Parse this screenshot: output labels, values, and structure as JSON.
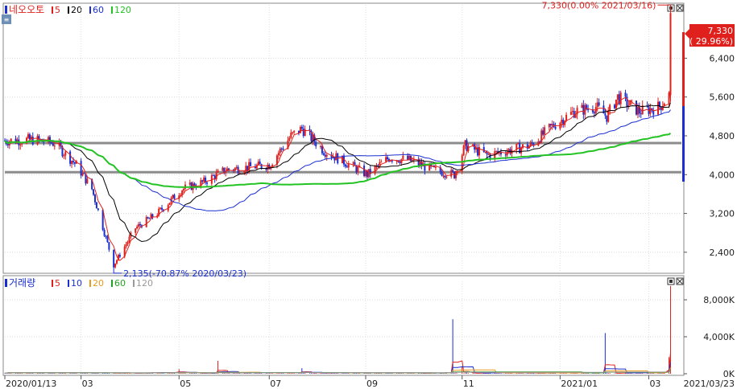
{
  "price_panel": {
    "stock_name": "네오오토",
    "ma_legend": [
      {
        "label": "5",
        "color": "#e0201c"
      },
      {
        "label": "20",
        "color": "#000000"
      },
      {
        "label": "60",
        "color": "#1b2fd0"
      },
      {
        "label": "120",
        "color": "#22c322"
      }
    ],
    "high_annotation": "7,330(0.00% 2021/03/16)",
    "low_annotation": "2,135(-70.87% 2020/03/23)",
    "current_price": "7,330",
    "current_change": "( 29.96%)",
    "y_ticks": [
      "6,400",
      "5,600",
      "4,800",
      "4,000",
      "3,200",
      "2,400"
    ]
  },
  "volume_panel": {
    "title": "거래량",
    "ma_legend": [
      {
        "label": "5",
        "color": "#e0201c"
      },
      {
        "label": "10",
        "color": "#1b2fd0"
      },
      {
        "label": "20",
        "color": "#e89a1a"
      },
      {
        "label": "60",
        "color": "#22a022"
      },
      {
        "label": "120",
        "color": "#999999"
      }
    ],
    "y_ticks": [
      "8,000K",
      "4,000K",
      "0K"
    ]
  },
  "x_axis": {
    "labels": [
      "2020/01/13",
      "03",
      "05",
      "07",
      "09",
      "11",
      "2021/01",
      "03"
    ],
    "end_label": "2021/03/23"
  },
  "colors": {
    "up": "#e0201c",
    "down": "#1b2fd0",
    "support_line": "#8c8c8c"
  },
  "chart_data": [
    {
      "type": "candlestick",
      "title": "네오오토",
      "x_range": [
        "2020/01/13",
        "2021/03/23"
      ],
      "ylim": [
        2000,
        7500
      ],
      "y_ticks": [
        6400,
        5600,
        4800,
        4000,
        3200,
        2400
      ],
      "horizontal_levels": [
        4650,
        4050
      ],
      "close_series": [
        {
          "date": "2020/01/13",
          "value": 4700
        },
        {
          "date": "2020/01/31",
          "value": 4720
        },
        {
          "date": "2020/02/14",
          "value": 4650
        },
        {
          "date": "2020/02/28",
          "value": 4200
        },
        {
          "date": "2020/03/09",
          "value": 3700
        },
        {
          "date": "2020/03/23",
          "value": 2135
        },
        {
          "date": "2020/04/06",
          "value": 2900
        },
        {
          "date": "2020/04/20",
          "value": 3200
        },
        {
          "date": "2020/05/06",
          "value": 3700
        },
        {
          "date": "2020/05/20",
          "value": 3850
        },
        {
          "date": "2020/06/03",
          "value": 4100
        },
        {
          "date": "2020/06/17",
          "value": 4150
        },
        {
          "date": "2020/07/01",
          "value": 4200
        },
        {
          "date": "2020/07/15",
          "value": 4800
        },
        {
          "date": "2020/07/22",
          "value": 4950
        },
        {
          "date": "2020/08/05",
          "value": 4500
        },
        {
          "date": "2020/08/19",
          "value": 4250
        },
        {
          "date": "2020/09/02",
          "value": 4000
        },
        {
          "date": "2020/09/16",
          "value": 4350
        },
        {
          "date": "2020/09/29",
          "value": 4300
        },
        {
          "date": "2020/10/14",
          "value": 4100
        },
        {
          "date": "2020/10/28",
          "value": 4000
        },
        {
          "date": "2020/11/04",
          "value": 4600
        },
        {
          "date": "2020/11/18",
          "value": 4400
        },
        {
          "date": "2020/12/02",
          "value": 4500
        },
        {
          "date": "2020/12/16",
          "value": 4600
        },
        {
          "date": "2020/12/30",
          "value": 5000
        },
        {
          "date": "2021/01/13",
          "value": 5300
        },
        {
          "date": "2021/01/27",
          "value": 5400
        },
        {
          "date": "2021/02/03",
          "value": 5200
        },
        {
          "date": "2021/02/10",
          "value": 5600
        },
        {
          "date": "2021/02/24",
          "value": 5300
        },
        {
          "date": "2021/03/09",
          "value": 5400
        },
        {
          "date": "2021/03/15",
          "value": 5640
        },
        {
          "date": "2021/03/16",
          "value": 7330
        }
      ],
      "moving_averages": [
        {
          "name": "5",
          "color": "#e0201c"
        },
        {
          "name": "20",
          "color": "#000000"
        },
        {
          "name": "60",
          "color": "#1b2fd0"
        },
        {
          "name": "120",
          "color": "#22c322"
        }
      ],
      "annotations": [
        {
          "text": "7,330(0.00% 2021/03/16)",
          "date": "2021/03/16",
          "value": 7330
        },
        {
          "text": "2,135(-70.87% 2020/03/23)",
          "date": "2020/03/23",
          "value": 2135
        }
      ]
    },
    {
      "type": "bar",
      "title": "거래량",
      "unit": "K",
      "ylim": [
        0,
        10000
      ],
      "y_ticks": [
        8000,
        4000,
        0
      ],
      "spikes": [
        {
          "date": "2020/02/26",
          "value": 150
        },
        {
          "date": "2020/05/04",
          "value": 500
        },
        {
          "date": "2020/05/29",
          "value": 1400
        },
        {
          "date": "2020/07/22",
          "value": 600
        },
        {
          "date": "2020/10/27",
          "value": 5900
        },
        {
          "date": "2020/11/02",
          "value": 800
        },
        {
          "date": "2021/02/02",
          "value": 4400
        },
        {
          "date": "2021/03/15",
          "value": 1800
        },
        {
          "date": "2021/03/16",
          "value": 9500
        }
      ]
    }
  ]
}
